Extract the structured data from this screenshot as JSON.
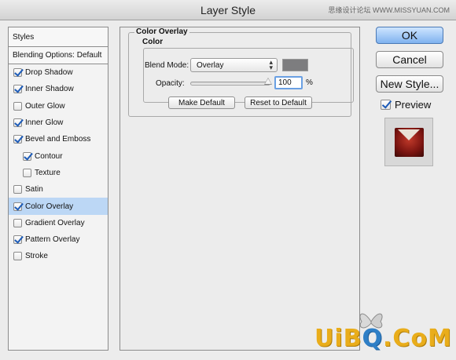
{
  "window": {
    "title": "Layer Style",
    "watermark": "思缘设计论坛  WWW.MISSYUAN.COM"
  },
  "left_panel": {
    "styles_label": "Styles",
    "blending_options": "Blending Options: Default",
    "items": [
      {
        "label": "Drop Shadow",
        "checked": true
      },
      {
        "label": "Inner Shadow",
        "checked": true
      },
      {
        "label": "Outer Glow",
        "checked": false
      },
      {
        "label": "Inner Glow",
        "checked": true
      },
      {
        "label": "Bevel and Emboss",
        "checked": true
      },
      {
        "label": "Contour",
        "checked": true
      },
      {
        "label": "Texture",
        "checked": false
      },
      {
        "label": "Satin",
        "checked": false
      },
      {
        "label": "Color Overlay",
        "checked": true,
        "selected": true
      },
      {
        "label": "Gradient Overlay",
        "checked": false
      },
      {
        "label": "Pattern Overlay",
        "checked": true
      },
      {
        "label": "Stroke",
        "checked": false
      }
    ]
  },
  "color_overlay": {
    "section_title": "Color Overlay",
    "group_title": "Color",
    "blend_mode_label": "Blend Mode:",
    "blend_mode_value": "Overlay",
    "swatch_color": "#7d7d7f",
    "opacity_label": "Opacity:",
    "opacity_value": "100",
    "opacity_unit": "%",
    "make_default": "Make Default",
    "reset_default": "Reset to Default"
  },
  "buttons": {
    "ok": "OK",
    "cancel": "Cancel",
    "new_style": "New Style...",
    "preview_label": "Preview",
    "preview_checked": true
  },
  "site_logo": {
    "text_a": "UiB",
    "text_b": "Q",
    "text_c": ".CoM"
  }
}
